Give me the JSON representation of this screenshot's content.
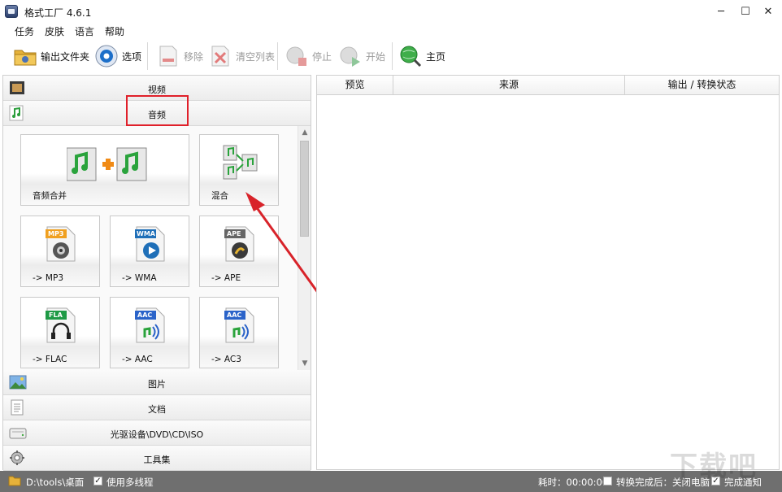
{
  "window": {
    "title": "格式工厂 4.6.1",
    "controls": {
      "minimize": "─",
      "maximize": "☐",
      "close": "✕"
    }
  },
  "menu": [
    "任务",
    "皮肤",
    "语言",
    "帮助"
  ],
  "toolbar": {
    "output_folder": "输出文件夹",
    "options": "选项",
    "remove": "移除",
    "clear_list": "清空列表",
    "stop": "停止",
    "start": "开始",
    "home": "主页"
  },
  "categories": {
    "video": "视频",
    "audio": "音频",
    "picture": "图片",
    "document": "文档",
    "rom": "光驱设备\\DVD\\CD\\ISO",
    "tools": "工具集"
  },
  "audio_tiles": [
    {
      "label": "音频合并"
    },
    {
      "label": "混合"
    },
    {
      "label": "-> MP3",
      "badge": "MP3",
      "badge_color": "#f0a020"
    },
    {
      "label": "-> WMA",
      "badge": "WMA",
      "badge_color": "#1f6fb8"
    },
    {
      "label": "-> APE",
      "badge": "APE",
      "badge_color": "#666666"
    },
    {
      "label": "-> FLAC",
      "badge": "FLA",
      "badge_color": "#1e9a45"
    },
    {
      "label": "-> AAC",
      "badge": "AAC",
      "badge_color": "#2a63c9"
    },
    {
      "label": "-> AC3",
      "badge": "AAC",
      "badge_color": "#2a63c9"
    }
  ],
  "table": {
    "columns": [
      "预览",
      "来源",
      "输出 / 转换状态"
    ]
  },
  "statusbar": {
    "path": "D:\\tools\\桌面",
    "multithread": "使用多线程",
    "elapsed_label": "耗时：00:00:00",
    "after_convert": "转换完成后：关闭电脑",
    "notify": "完成通知"
  },
  "watermark": "下载吧",
  "colors": {
    "highlight_box": "#e0202a",
    "arrow": "#d8232a",
    "statusbar": "#6f6f6f"
  }
}
